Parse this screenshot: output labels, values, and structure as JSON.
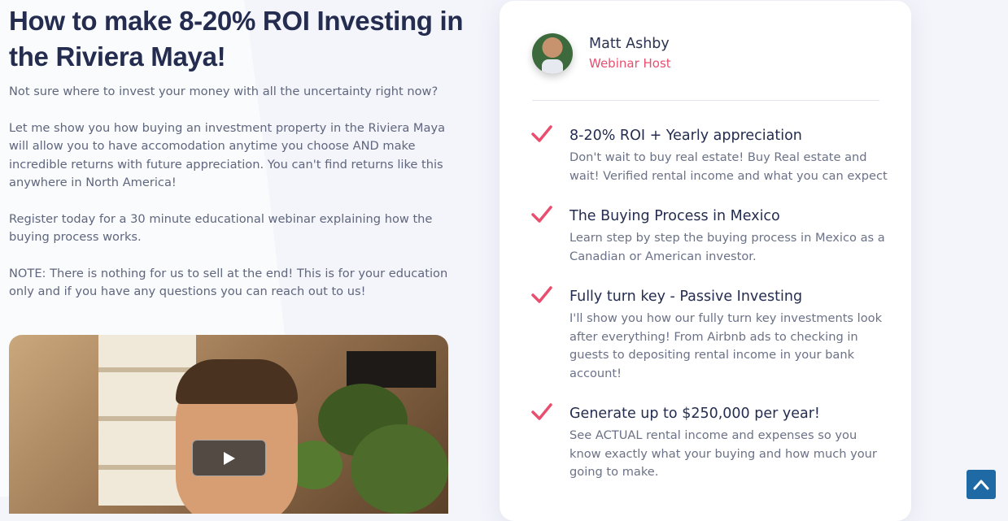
{
  "left": {
    "title": "How to make 8-20% ROI Investing in the Riviera Maya!",
    "paragraphs": [
      "Not sure where to invest your money with all the uncertainty right now?",
      "Let me show you how buying an investment property in the Riviera Maya will allow you to have accomodation anytime you choose AND make incredible returns with future appreciation. You can't find returns like this anywhere in North America!",
      "Register today for a 30 minute educational webinar explaining how the buying process works.",
      "NOTE: There is nothing for us to sell at the end! This is for your education only and if you have any questions you can reach out to us!"
    ]
  },
  "host": {
    "name": "Matt Ashby",
    "role": "Webinar Host"
  },
  "features": [
    {
      "title": "8-20% ROI + Yearly appreciation",
      "description": "Don't wait to buy real estate! Buy Real estate and wait! Verified rental income and what you can expect"
    },
    {
      "title": "The Buying Process in Mexico",
      "description": "Learn step by step the buying process in Mexico as a Canadian or American investor."
    },
    {
      "title": "Fully turn key - Passive Investing",
      "description": "I'll show you how our fully turn key investments look after everything! From Airbnb ads to checking in guests to depositing rental income in your bank account!"
    },
    {
      "title": "Generate up to $250,000 per year!",
      "description": "See ACTUAL rental income and expenses so you know exactly what your buying and how much your going to make."
    }
  ],
  "icons": {
    "check": "check-icon",
    "play": "play-icon",
    "scroll_top": "chevron-up-icon"
  },
  "colors": {
    "accent": "#ea4e6f",
    "title": "#242d4f",
    "body_text": "#5f667d",
    "scroll_button": "#1f6aa5"
  }
}
